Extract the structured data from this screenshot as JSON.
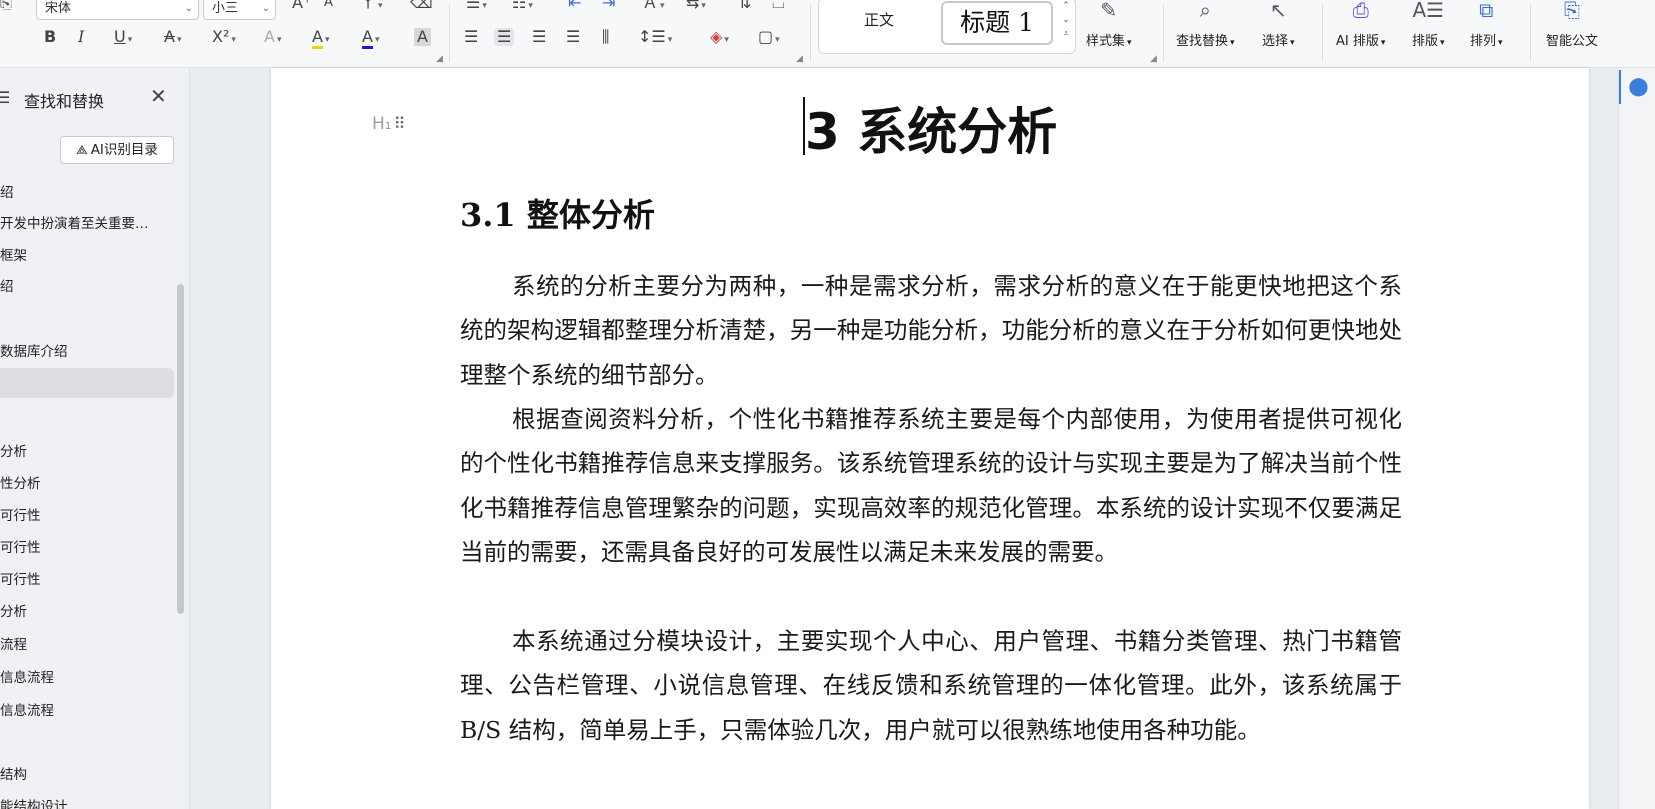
{
  "ribbon": {
    "font_name": "宋体",
    "font_size": "小三",
    "style_normal": "正文",
    "style_heading1": "标题 1",
    "buttons": {
      "style_set": "样式集",
      "find_replace": "查找替换",
      "select": "选择",
      "ai_layout": "AI 排版",
      "layout": "排版",
      "arrange": "排列",
      "smart_doc": "智能公文"
    },
    "icons": {
      "bold": "B",
      "italic": "I",
      "underline": "U",
      "strike": "A",
      "superscript": "X²",
      "text_effect": "A",
      "highlight": "A",
      "font_color": "A",
      "char_shade": "A",
      "grow_font": "A⁺",
      "shrink_font": "A⁻",
      "pinyin": "ㄚ",
      "clear": "⌫"
    },
    "colors": {
      "highlight": "#f2d200",
      "font_color": "#1a1ae0"
    }
  },
  "left_pane": {
    "title": "查找和替换",
    "ai_button": "AI识别目录",
    "toc": [
      "绍",
      "开发中扮演着至关重要…",
      "框架",
      "绍",
      "数据库介绍",
      "",
      "分析",
      "性分析",
      "可行性",
      "可行性",
      "可行性",
      "分析",
      "流程",
      "信息流程",
      "信息流程",
      "结构",
      "能结构设计"
    ]
  },
  "document": {
    "h1_tag": "H₁",
    "chapter_title": "3 系统分析",
    "section_title": "3.1 整体分析",
    "paragraphs": [
      "系统的分析主要分为两种，一种是需求分析，需求分析的意义在于能更快地把这个系统的架构逻辑都整理分析清楚，另一种是功能分析，功能分析的意义在于分析如何更快地处理整个系统的细节部分。",
      "根据查阅资料分析，个性化书籍推荐系统主要是每个内部使用，为使用者提供可视化的个性化书籍推荐信息来支撑服务。该系统管理系统的设计与实现主要是为了解决当前个性化书籍推荐信息管理繁杂的问题，实现高效率的规范化管理。本系统的设计实现不仅要满足当前的需要，还需具备良好的可发展性以满足未来发展的需要。",
      "本系统通过分模块设计，主要实现个人中心、用户管理、书籍分类管理、热门书籍管理、公告栏管理、小说信息管理、在线反馈和系统管理的一体化管理。此外，该系统属于B/S 结构，简单易上手，只需体验几次，用户就可以很熟练地使用各种功能。"
    ]
  }
}
